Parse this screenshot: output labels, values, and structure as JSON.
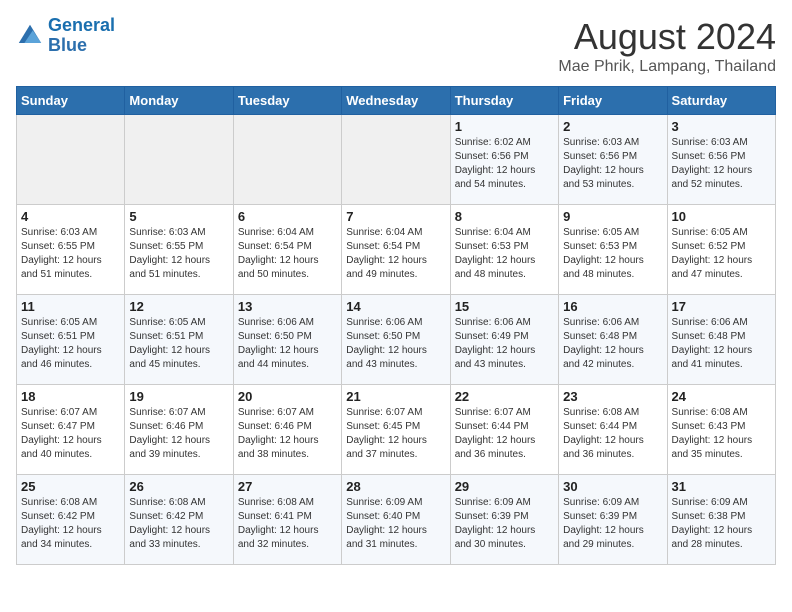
{
  "header": {
    "logo_line1": "General",
    "logo_line2": "Blue",
    "month_year": "August 2024",
    "location": "Mae Phrik, Lampang, Thailand"
  },
  "weekdays": [
    "Sunday",
    "Monday",
    "Tuesday",
    "Wednesday",
    "Thursday",
    "Friday",
    "Saturday"
  ],
  "weeks": [
    [
      {
        "day": "",
        "sunrise": "",
        "sunset": "",
        "daylight": ""
      },
      {
        "day": "",
        "sunrise": "",
        "sunset": "",
        "daylight": ""
      },
      {
        "day": "",
        "sunrise": "",
        "sunset": "",
        "daylight": ""
      },
      {
        "day": "",
        "sunrise": "",
        "sunset": "",
        "daylight": ""
      },
      {
        "day": "1",
        "sunrise": "Sunrise: 6:02 AM",
        "sunset": "Sunset: 6:56 PM",
        "daylight": "Daylight: 12 hours and 54 minutes."
      },
      {
        "day": "2",
        "sunrise": "Sunrise: 6:03 AM",
        "sunset": "Sunset: 6:56 PM",
        "daylight": "Daylight: 12 hours and 53 minutes."
      },
      {
        "day": "3",
        "sunrise": "Sunrise: 6:03 AM",
        "sunset": "Sunset: 6:56 PM",
        "daylight": "Daylight: 12 hours and 52 minutes."
      }
    ],
    [
      {
        "day": "4",
        "sunrise": "Sunrise: 6:03 AM",
        "sunset": "Sunset: 6:55 PM",
        "daylight": "Daylight: 12 hours and 51 minutes."
      },
      {
        "day": "5",
        "sunrise": "Sunrise: 6:03 AM",
        "sunset": "Sunset: 6:55 PM",
        "daylight": "Daylight: 12 hours and 51 minutes."
      },
      {
        "day": "6",
        "sunrise": "Sunrise: 6:04 AM",
        "sunset": "Sunset: 6:54 PM",
        "daylight": "Daylight: 12 hours and 50 minutes."
      },
      {
        "day": "7",
        "sunrise": "Sunrise: 6:04 AM",
        "sunset": "Sunset: 6:54 PM",
        "daylight": "Daylight: 12 hours and 49 minutes."
      },
      {
        "day": "8",
        "sunrise": "Sunrise: 6:04 AM",
        "sunset": "Sunset: 6:53 PM",
        "daylight": "Daylight: 12 hours and 48 minutes."
      },
      {
        "day": "9",
        "sunrise": "Sunrise: 6:05 AM",
        "sunset": "Sunset: 6:53 PM",
        "daylight": "Daylight: 12 hours and 48 minutes."
      },
      {
        "day": "10",
        "sunrise": "Sunrise: 6:05 AM",
        "sunset": "Sunset: 6:52 PM",
        "daylight": "Daylight: 12 hours and 47 minutes."
      }
    ],
    [
      {
        "day": "11",
        "sunrise": "Sunrise: 6:05 AM",
        "sunset": "Sunset: 6:51 PM",
        "daylight": "Daylight: 12 hours and 46 minutes."
      },
      {
        "day": "12",
        "sunrise": "Sunrise: 6:05 AM",
        "sunset": "Sunset: 6:51 PM",
        "daylight": "Daylight: 12 hours and 45 minutes."
      },
      {
        "day": "13",
        "sunrise": "Sunrise: 6:06 AM",
        "sunset": "Sunset: 6:50 PM",
        "daylight": "Daylight: 12 hours and 44 minutes."
      },
      {
        "day": "14",
        "sunrise": "Sunrise: 6:06 AM",
        "sunset": "Sunset: 6:50 PM",
        "daylight": "Daylight: 12 hours and 43 minutes."
      },
      {
        "day": "15",
        "sunrise": "Sunrise: 6:06 AM",
        "sunset": "Sunset: 6:49 PM",
        "daylight": "Daylight: 12 hours and 43 minutes."
      },
      {
        "day": "16",
        "sunrise": "Sunrise: 6:06 AM",
        "sunset": "Sunset: 6:48 PM",
        "daylight": "Daylight: 12 hours and 42 minutes."
      },
      {
        "day": "17",
        "sunrise": "Sunrise: 6:06 AM",
        "sunset": "Sunset: 6:48 PM",
        "daylight": "Daylight: 12 hours and 41 minutes."
      }
    ],
    [
      {
        "day": "18",
        "sunrise": "Sunrise: 6:07 AM",
        "sunset": "Sunset: 6:47 PM",
        "daylight": "Daylight: 12 hours and 40 minutes."
      },
      {
        "day": "19",
        "sunrise": "Sunrise: 6:07 AM",
        "sunset": "Sunset: 6:46 PM",
        "daylight": "Daylight: 12 hours and 39 minutes."
      },
      {
        "day": "20",
        "sunrise": "Sunrise: 6:07 AM",
        "sunset": "Sunset: 6:46 PM",
        "daylight": "Daylight: 12 hours and 38 minutes."
      },
      {
        "day": "21",
        "sunrise": "Sunrise: 6:07 AM",
        "sunset": "Sunset: 6:45 PM",
        "daylight": "Daylight: 12 hours and 37 minutes."
      },
      {
        "day": "22",
        "sunrise": "Sunrise: 6:07 AM",
        "sunset": "Sunset: 6:44 PM",
        "daylight": "Daylight: 12 hours and 36 minutes."
      },
      {
        "day": "23",
        "sunrise": "Sunrise: 6:08 AM",
        "sunset": "Sunset: 6:44 PM",
        "daylight": "Daylight: 12 hours and 36 minutes."
      },
      {
        "day": "24",
        "sunrise": "Sunrise: 6:08 AM",
        "sunset": "Sunset: 6:43 PM",
        "daylight": "Daylight: 12 hours and 35 minutes."
      }
    ],
    [
      {
        "day": "25",
        "sunrise": "Sunrise: 6:08 AM",
        "sunset": "Sunset: 6:42 PM",
        "daylight": "Daylight: 12 hours and 34 minutes."
      },
      {
        "day": "26",
        "sunrise": "Sunrise: 6:08 AM",
        "sunset": "Sunset: 6:42 PM",
        "daylight": "Daylight: 12 hours and 33 minutes."
      },
      {
        "day": "27",
        "sunrise": "Sunrise: 6:08 AM",
        "sunset": "Sunset: 6:41 PM",
        "daylight": "Daylight: 12 hours and 32 minutes."
      },
      {
        "day": "28",
        "sunrise": "Sunrise: 6:09 AM",
        "sunset": "Sunset: 6:40 PM",
        "daylight": "Daylight: 12 hours and 31 minutes."
      },
      {
        "day": "29",
        "sunrise": "Sunrise: 6:09 AM",
        "sunset": "Sunset: 6:39 PM",
        "daylight": "Daylight: 12 hours and 30 minutes."
      },
      {
        "day": "30",
        "sunrise": "Sunrise: 6:09 AM",
        "sunset": "Sunset: 6:39 PM",
        "daylight": "Daylight: 12 hours and 29 minutes."
      },
      {
        "day": "31",
        "sunrise": "Sunrise: 6:09 AM",
        "sunset": "Sunset: 6:38 PM",
        "daylight": "Daylight: 12 hours and 28 minutes."
      }
    ]
  ]
}
